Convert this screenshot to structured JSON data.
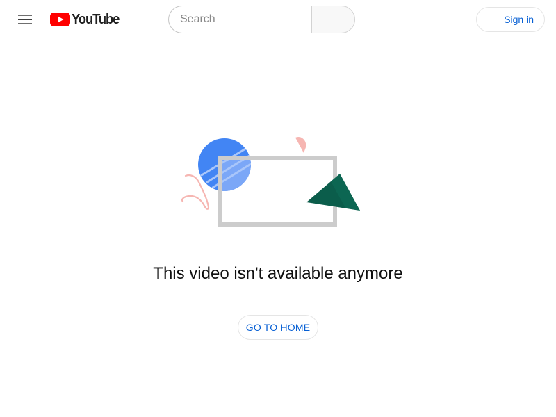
{
  "header": {
    "menu_icon": "hamburger-menu-icon",
    "logo_text": "YouTube",
    "logo_icon": "youtube-play-icon",
    "brand_color": "#ff0000",
    "search": {
      "placeholder": "Search",
      "value": ""
    },
    "signin_label": "Sign in"
  },
  "main": {
    "illustration": "video-unavailable-illustration",
    "message": "This video isn't available anymore",
    "home_button_label": "GO TO HOME"
  },
  "colors": {
    "link_blue": "#065fd4",
    "circle_blue": "#4285f4",
    "frame_gray": "#cccccc",
    "triangle_green": "#0b5d4b",
    "accent_pink": "#f6b6b2"
  }
}
